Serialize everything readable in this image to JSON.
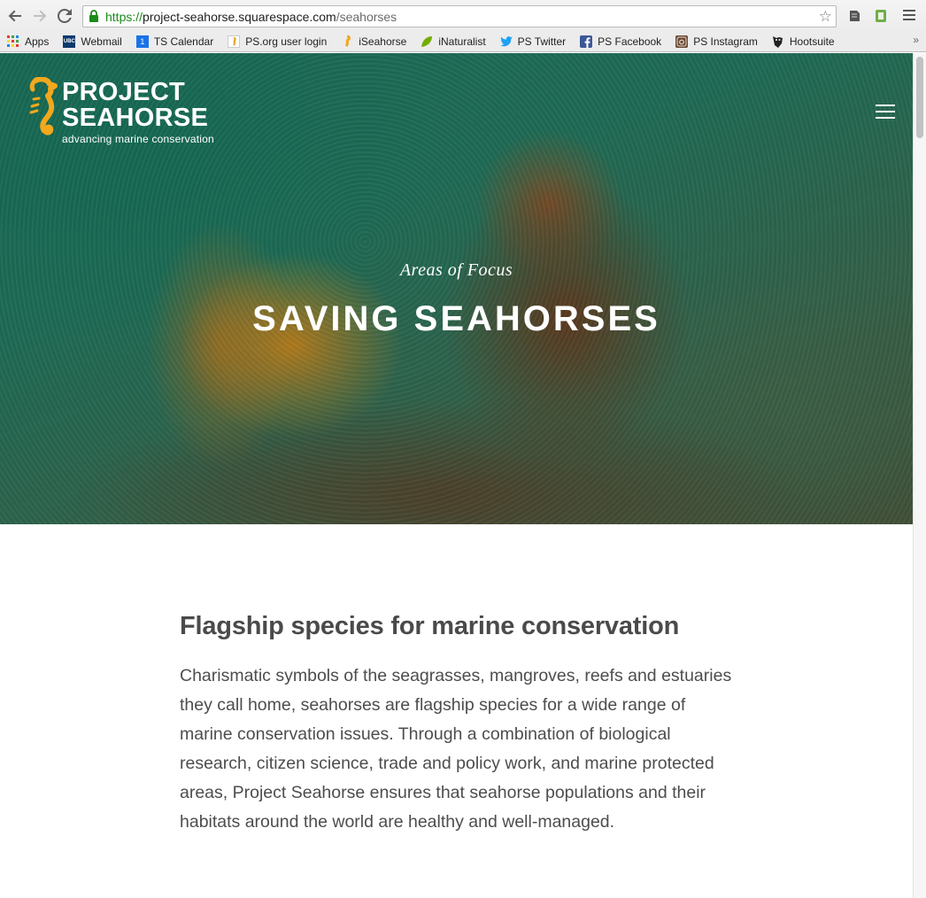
{
  "browser": {
    "url_scheme": "https://",
    "url_host": "project-seahorse.squarespace.com",
    "url_path": "/seahorses",
    "bookmarks": [
      {
        "label": "Apps",
        "icon": "apps-grid-icon"
      },
      {
        "label": "Webmail",
        "icon": "ubc-icon"
      },
      {
        "label": "TS Calendar",
        "icon": "calendar-icon"
      },
      {
        "label": "PS.org user login",
        "icon": "seahorse-page-icon"
      },
      {
        "label": "iSeahorse",
        "icon": "seahorse-icon"
      },
      {
        "label": "iNaturalist",
        "icon": "leaf-icon"
      },
      {
        "label": "PS Twitter",
        "icon": "twitter-icon"
      },
      {
        "label": "PS Facebook",
        "icon": "facebook-icon"
      },
      {
        "label": "PS Instagram",
        "icon": "instagram-icon"
      },
      {
        "label": "Hootsuite",
        "icon": "hootsuite-icon"
      }
    ],
    "more": "»"
  },
  "site": {
    "logo_line1": "PROJECT",
    "logo_line2": "SEAHORSE",
    "logo_tagline": "advancing marine conservation",
    "accent_color": "#f2a81d"
  },
  "hero": {
    "subtitle": "Areas of Focus",
    "title": "SAVING SEAHORSES"
  },
  "article": {
    "heading": "Flagship species for marine conservation",
    "body": "Charismatic symbols of the seagrasses, mangroves, reefs and estuaries they call home, seahorses are flagship species for a wide range of marine conservation issues. Through a combination of biological research, citizen science, trade and policy work, and marine protected areas, Project Seahorse ensures that seahorse populations and their habitats around the world are healthy and well-managed."
  }
}
